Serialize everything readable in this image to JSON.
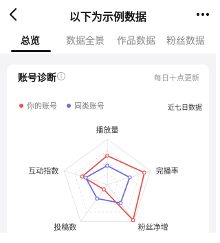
{
  "header": {
    "title": "以下为示例数据"
  },
  "tabs": [
    {
      "label": "总览",
      "active": true
    },
    {
      "label": "数据全景",
      "active": false
    },
    {
      "label": "作品数据",
      "active": false
    },
    {
      "label": "粉丝数据",
      "active": false
    }
  ],
  "card": {
    "title": "账号诊断",
    "update_note": "每日十点更新",
    "period": "近七日数据"
  },
  "chart_data": {
    "type": "radar",
    "axes": [
      "播放量",
      "完播率",
      "粉丝净增",
      "投稿数",
      "互动指数"
    ],
    "range": [
      0,
      1
    ],
    "series": [
      {
        "name": "你的账号",
        "color": "#e8524a",
        "values": [
          0.64,
          0.86,
          0.97,
          0.13,
          0.58
        ]
      },
      {
        "name": "同类账号",
        "color": "#6b6ee0",
        "values": [
          0.42,
          0.52,
          0.5,
          0.38,
          0.5
        ]
      }
    ],
    "grid_rings": 4
  },
  "colors": {
    "mine": "#e8524a",
    "peer": "#6b6ee0",
    "grid": "#e3e3e3"
  }
}
